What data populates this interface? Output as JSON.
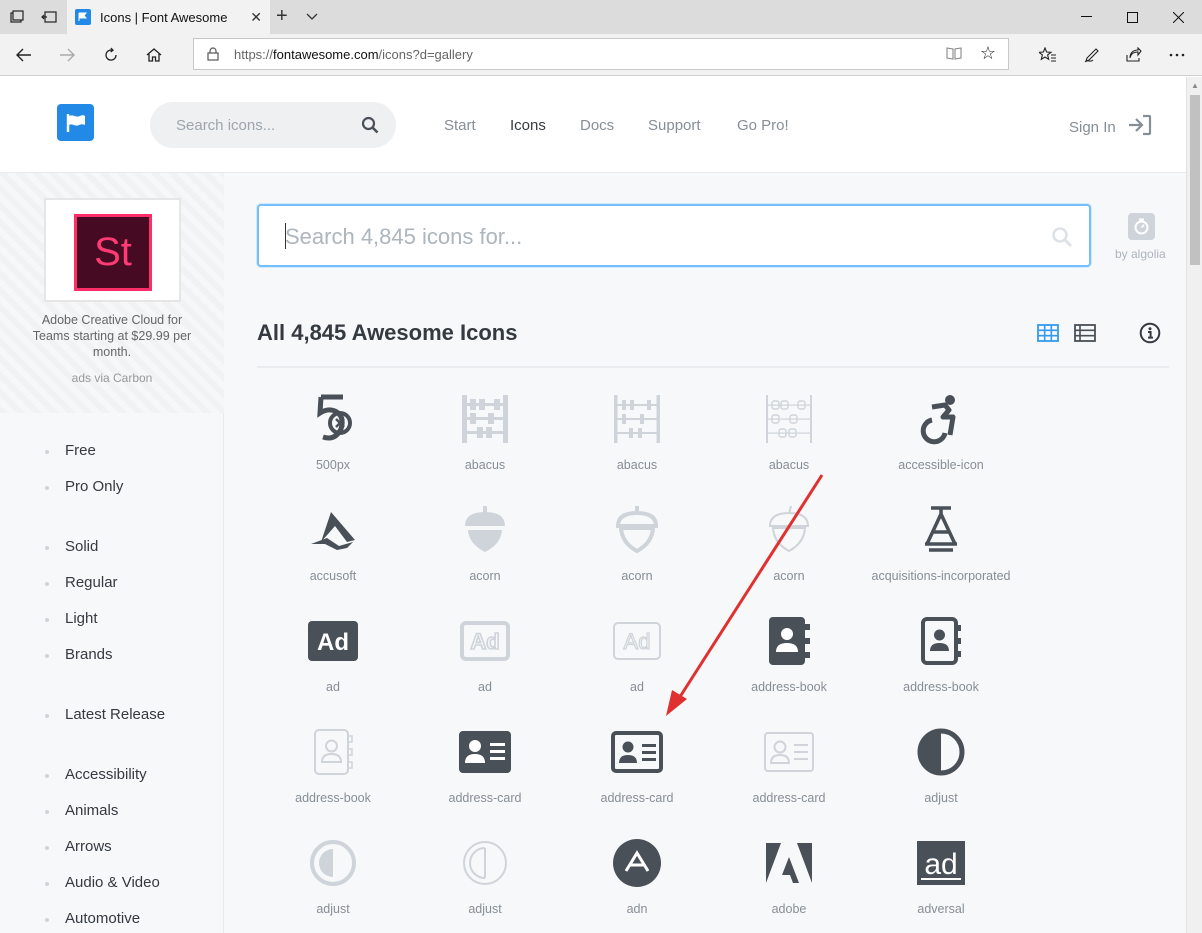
{
  "browser": {
    "tab_title": "Icons | Font Awesome",
    "url_prefix": "https://",
    "url_domain": "fontawesome.com",
    "url_path": "/icons?d=gallery"
  },
  "header": {
    "search_placeholder": "Search icons...",
    "nav": [
      "Start",
      "Icons",
      "Docs",
      "Support",
      "Go Pro!"
    ],
    "active_nav": "Icons",
    "sign_in": "Sign In"
  },
  "sidebar": {
    "ad": {
      "logo_text": "St",
      "text": "Adobe Creative Cloud for Teams starting at $29.99 per month.",
      "via": "ads via Carbon"
    },
    "filters": [
      "Free",
      "Pro Only",
      "Solid",
      "Regular",
      "Light",
      "Brands",
      "Latest Release",
      "Accessibility",
      "Animals",
      "Arrows",
      "Audio & Video",
      "Automotive"
    ]
  },
  "main": {
    "search_placeholder": "Search 4,845 icons for...",
    "algolia": "by algolia",
    "heading": "All 4,845 Awesome Icons"
  },
  "icons": [
    {
      "label": "500px",
      "icon": "500px-icon"
    },
    {
      "label": "abacus",
      "icon": "abacus-icon"
    },
    {
      "label": "abacus",
      "icon": "abacus-icon"
    },
    {
      "label": "abacus",
      "icon": "abacus-icon"
    },
    {
      "label": "accessible-icon",
      "icon": "accessible-icon"
    },
    {
      "label": "accusoft",
      "icon": "accusoft-icon"
    },
    {
      "label": "acorn",
      "icon": "acorn-icon"
    },
    {
      "label": "acorn",
      "icon": "acorn-icon"
    },
    {
      "label": "acorn",
      "icon": "acorn-icon"
    },
    {
      "label": "acquisitions-incorporated",
      "icon": "acquisitions-incorporated-icon"
    },
    {
      "label": "ad",
      "icon": "ad-icon"
    },
    {
      "label": "ad",
      "icon": "ad-icon"
    },
    {
      "label": "ad",
      "icon": "ad-icon"
    },
    {
      "label": "address-book",
      "icon": "address-book-icon"
    },
    {
      "label": "address-book",
      "icon": "address-book-icon"
    },
    {
      "label": "address-book",
      "icon": "address-book-icon"
    },
    {
      "label": "address-card",
      "icon": "address-card-icon"
    },
    {
      "label": "address-card",
      "icon": "address-card-icon"
    },
    {
      "label": "address-card",
      "icon": "address-card-icon"
    },
    {
      "label": "adjust",
      "icon": "adjust-icon"
    },
    {
      "label": "adjust",
      "icon": "adjust-icon"
    },
    {
      "label": "adjust",
      "icon": "adjust-icon"
    },
    {
      "label": "adn",
      "icon": "adn-icon"
    },
    {
      "label": "adobe",
      "icon": "adobe-icon"
    },
    {
      "label": "adversal",
      "icon": "adversal-icon"
    }
  ],
  "colors": {
    "brand": "#228ae6",
    "icon_dark": "#495057",
    "icon_light": "#ced4da",
    "annotation_arrow": "#e03131"
  }
}
